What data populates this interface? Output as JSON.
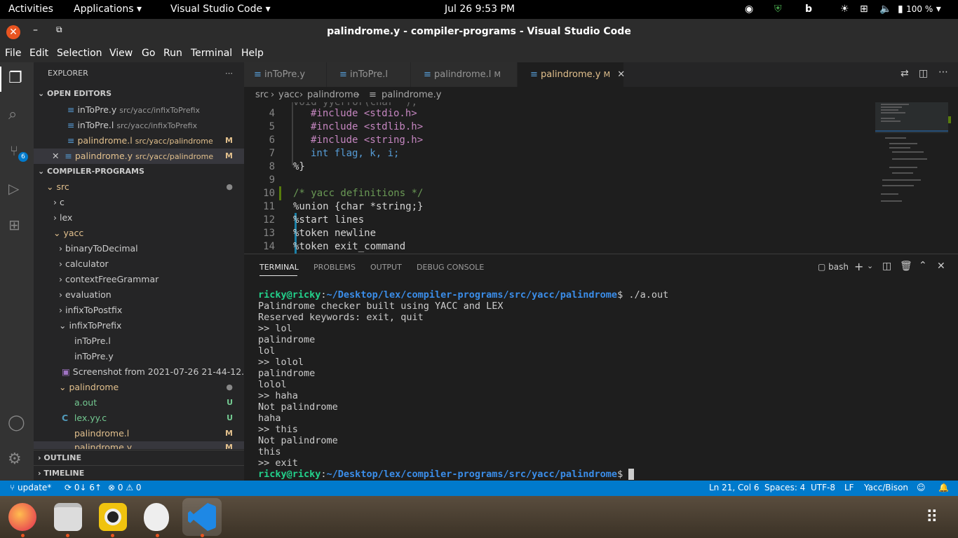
{
  "topbar": {
    "activities": "Activities",
    "applications": "Applications",
    "app": "Visual Studio Code",
    "clock": "Jul 26   9:53 PM",
    "battery": "100 %"
  },
  "window": {
    "title": "palindrome.y - compiler-programs - Visual Studio Code"
  },
  "menu": [
    "File",
    "Edit",
    "Selection",
    "View",
    "Go",
    "Run",
    "Terminal",
    "Help"
  ],
  "activity": {
    "scm_badge": "6"
  },
  "explorer": {
    "title": "EXPLORER",
    "open_editors": "OPEN EDITORS",
    "project": "COMPILER-PROGRAMS",
    "outline": "OUTLINE",
    "timeline": "TIMELINE",
    "open": [
      {
        "name": "inToPre.y",
        "path": "src/yacc/infixToPrefix",
        "badge": ""
      },
      {
        "name": "inToPre.l",
        "path": "src/yacc/infixToPrefix",
        "badge": ""
      },
      {
        "name": "palindrome.l",
        "path": "src/yacc/palindrome",
        "badge": "M"
      },
      {
        "name": "palindrome.y",
        "path": "src/yacc/palindrome",
        "badge": "M"
      }
    ],
    "tree": [
      {
        "label": "src",
        "badge": "●"
      },
      {
        "label": "c",
        "badge": ""
      },
      {
        "label": "lex",
        "badge": ""
      },
      {
        "label": "yacc",
        "badge": ""
      },
      {
        "label": "binaryToDecimal",
        "badge": ""
      },
      {
        "label": "calculator",
        "badge": ""
      },
      {
        "label": "contextFreeGrammar",
        "badge": ""
      },
      {
        "label": "evaluation",
        "badge": ""
      },
      {
        "label": "infixToPostfix",
        "badge": ""
      },
      {
        "label": "infixToPrefix",
        "badge": ""
      },
      {
        "label": "inToPre.l",
        "badge": ""
      },
      {
        "label": "inToPre.y",
        "badge": ""
      },
      {
        "label": "Screenshot from 2021-07-26 21-44-12....",
        "badge": ""
      },
      {
        "label": "palindrome",
        "badge": "●"
      },
      {
        "label": "a.out",
        "badge": "U"
      },
      {
        "label": "lex.yy.c",
        "badge": "U"
      },
      {
        "label": "palindrome.l",
        "badge": "M"
      },
      {
        "label": "palindrome.y",
        "badge": "M"
      }
    ]
  },
  "tabs": [
    {
      "label": "inToPre.y",
      "mod": ""
    },
    {
      "label": "inToPre.l",
      "mod": ""
    },
    {
      "label": "palindrome.l",
      "mod": "M"
    },
    {
      "label": "palindrome.y",
      "mod": "M"
    }
  ],
  "breadcrumb": {
    "a": "src",
    "b": "yacc",
    "c": "palindrome",
    "d": "palindrome.y"
  },
  "editor": {
    "lines": [
      "4",
      "5",
      "6",
      "7",
      "8",
      "9",
      "10",
      "11",
      "12",
      "13",
      "14"
    ],
    "code": [
      [
        "#include <stdio.h>"
      ],
      [
        "#include <stdlib.h>"
      ],
      [
        "#include <string.h>"
      ],
      [
        "int flag, k, i;"
      ],
      [
        "%}"
      ],
      [
        ""
      ],
      [
        "/* yacc definitions */"
      ],
      [
        "%union {char *string;}"
      ],
      [
        "%start lines"
      ],
      [
        "%token newline"
      ],
      [
        "%token exit_command"
      ]
    ]
  },
  "panel": {
    "tabs": [
      "TERMINAL",
      "PROBLEMS",
      "OUTPUT",
      "DEBUG CONSOLE"
    ],
    "shell": "bash",
    "prompt_user": "ricky@ricky",
    "prompt_path": "~/Desktop/lex/compiler-programs/src/yacc/palindrome",
    "cmd": "$ ./a.out",
    "lines": [
      "Palindrome checker built using YACC and LEX",
      "Reserved keywords: exit, quit",
      ">> lol",
      "palindrome",
      "lol",
      ">> lolol",
      "palindrome",
      "lolol",
      ">> haha",
      "Not palindrome",
      "haha",
      ">> this",
      "Not palindrome",
      "this",
      ">> exit"
    ],
    "end": "$ "
  },
  "status": {
    "branch": "update*",
    "sync": "0↓ 6↑",
    "problems": "⊗ 0 ⚠ 0",
    "pos": "Ln 21, Col 6",
    "spaces": "Spaces: 4",
    "enc": "UTF-8",
    "eol": "LF",
    "lang": "Yacc/Bison"
  }
}
